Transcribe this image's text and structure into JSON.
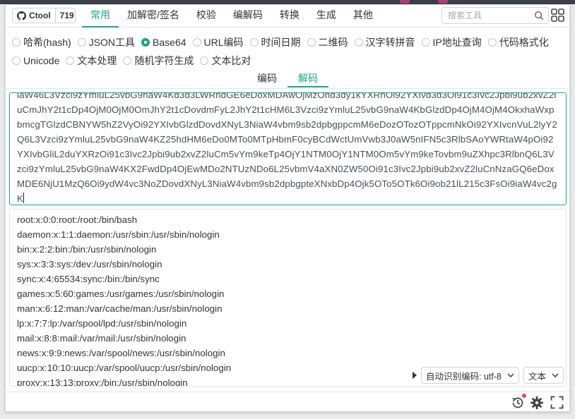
{
  "header": {
    "github_label": "Ctool",
    "github_count": "719",
    "tabs": [
      {
        "label": "常用",
        "active": true
      },
      {
        "label": "加解密/签名",
        "active": false
      },
      {
        "label": "校验",
        "active": false
      },
      {
        "label": "编解码",
        "active": false
      },
      {
        "label": "转换",
        "active": false
      },
      {
        "label": "生成",
        "active": false
      },
      {
        "label": "其他",
        "active": false
      }
    ],
    "search_placeholder": "搜索工具"
  },
  "tools": [
    {
      "label": "哈希(hash)",
      "checked": false
    },
    {
      "label": "JSON工具",
      "checked": false
    },
    {
      "label": "Base64",
      "checked": true
    },
    {
      "label": "URL编码",
      "checked": false
    },
    {
      "label": "时间日期",
      "checked": false
    },
    {
      "label": "二维码",
      "checked": false
    },
    {
      "label": "汉字转拼音",
      "checked": false
    },
    {
      "label": "IP地址查询",
      "checked": false
    },
    {
      "label": "代码格式化",
      "checked": false
    },
    {
      "label": "Unicode",
      "checked": false
    },
    {
      "label": "文本处理",
      "checked": false
    },
    {
      "label": "随机字符生成",
      "checked": false
    },
    {
      "label": "文本比对",
      "checked": false
    }
  ],
  "modes": [
    {
      "label": "编码",
      "active": false
    },
    {
      "label": "解码",
      "active": true
    }
  ],
  "input_text": "laW46L3Vzci9zYmluL25vbG9naW4Kd3d3LWRhdGE6eDoxMDAwOjMzOnd3dy1kYXRhOi92YXIvd3d3Oi91c3Ivc2Jpbi9ub2xvZ2luCmJhY2t1cDp4OjM0OjM0OmJhY2t1cDovdmFyL2JhY2t1cHM6L3Vzci9zYmluL25vbG9naW4KbGlzdDp4OjM4OjM4OkxhaWxpbmcgTGlzdCBNYW5hZ2VyOi92YXIvbGlzdDovdXNyL3NiaW4vbm9sb2dpbgppcmM6eDozOTozOTppcmNkOi92YXIvcnVuL2lyY2Q6L3Vzci9zYmluL25vbG9naW4KZ25hdHM6eDo0MTo0MTpHbmF0cyBCdWctUmVwb3J0aW5nIFN5c3RlbSAoYWRtaW4pOi92YXIvbGliL2duYXRzOi91c3Ivc2Jpbi9ub2xvZ2luCm5vYm9keTp4OjY1NTM0OjY1NTM0Om5vYm9keTovbm9uZXhpc3RlbnQ6L3Vzci9zYmluL25vbG9naW4KX2FwdDp4OjEwMDo2NTUzNDo6L25vbmV4aXN0ZW50Oi91c3Ivc2Jpbi9ub2xvZ2luCnNzaGQ6eDoxMDE6NjU1MzQ6Oi9ydW4vc3NoZDovdXNyL3NiaW4vbm9sb2dpbgpteXNxbDp4Ojk5OTo5OTk6Oi9ob21lL215c3FsOi9iaW4vc2gK",
  "output_lines": [
    "root:x:0:0:root:/root:/bin/bash",
    "daemon:x:1:1:daemon:/usr/sbin:/usr/sbin/nologin",
    "bin:x:2:2:bin:/bin:/usr/sbin/nologin",
    "sys:x:3:3:sys:/dev:/usr/sbin/nologin",
    "sync:x:4:65534:sync:/bin:/bin/sync",
    "games:x:5:60:games:/usr/games:/usr/sbin/nologin",
    "man:x:6:12:man:/var/cache/man:/usr/sbin/nologin",
    "lp:x:7:7:lp:/var/spool/lpd:/usr/sbin/nologin",
    "mail:x:8:8:mail:/var/mail:/usr/sbin/nologin",
    "news:x:9:9:news:/var/spool/news:/usr/sbin/nologin",
    "uucp:x:10:10:uucp:/var/spool/uucp:/usr/sbin/nologin",
    "proxy:x:13:13:proxy:/bin:/usr/sbin/nologin"
  ],
  "output_options": {
    "encoding_select": "自动识别编码: utf-8",
    "format_select": "文本"
  },
  "colors": {
    "accent": "#1ba784",
    "notification": "#e5484d"
  }
}
